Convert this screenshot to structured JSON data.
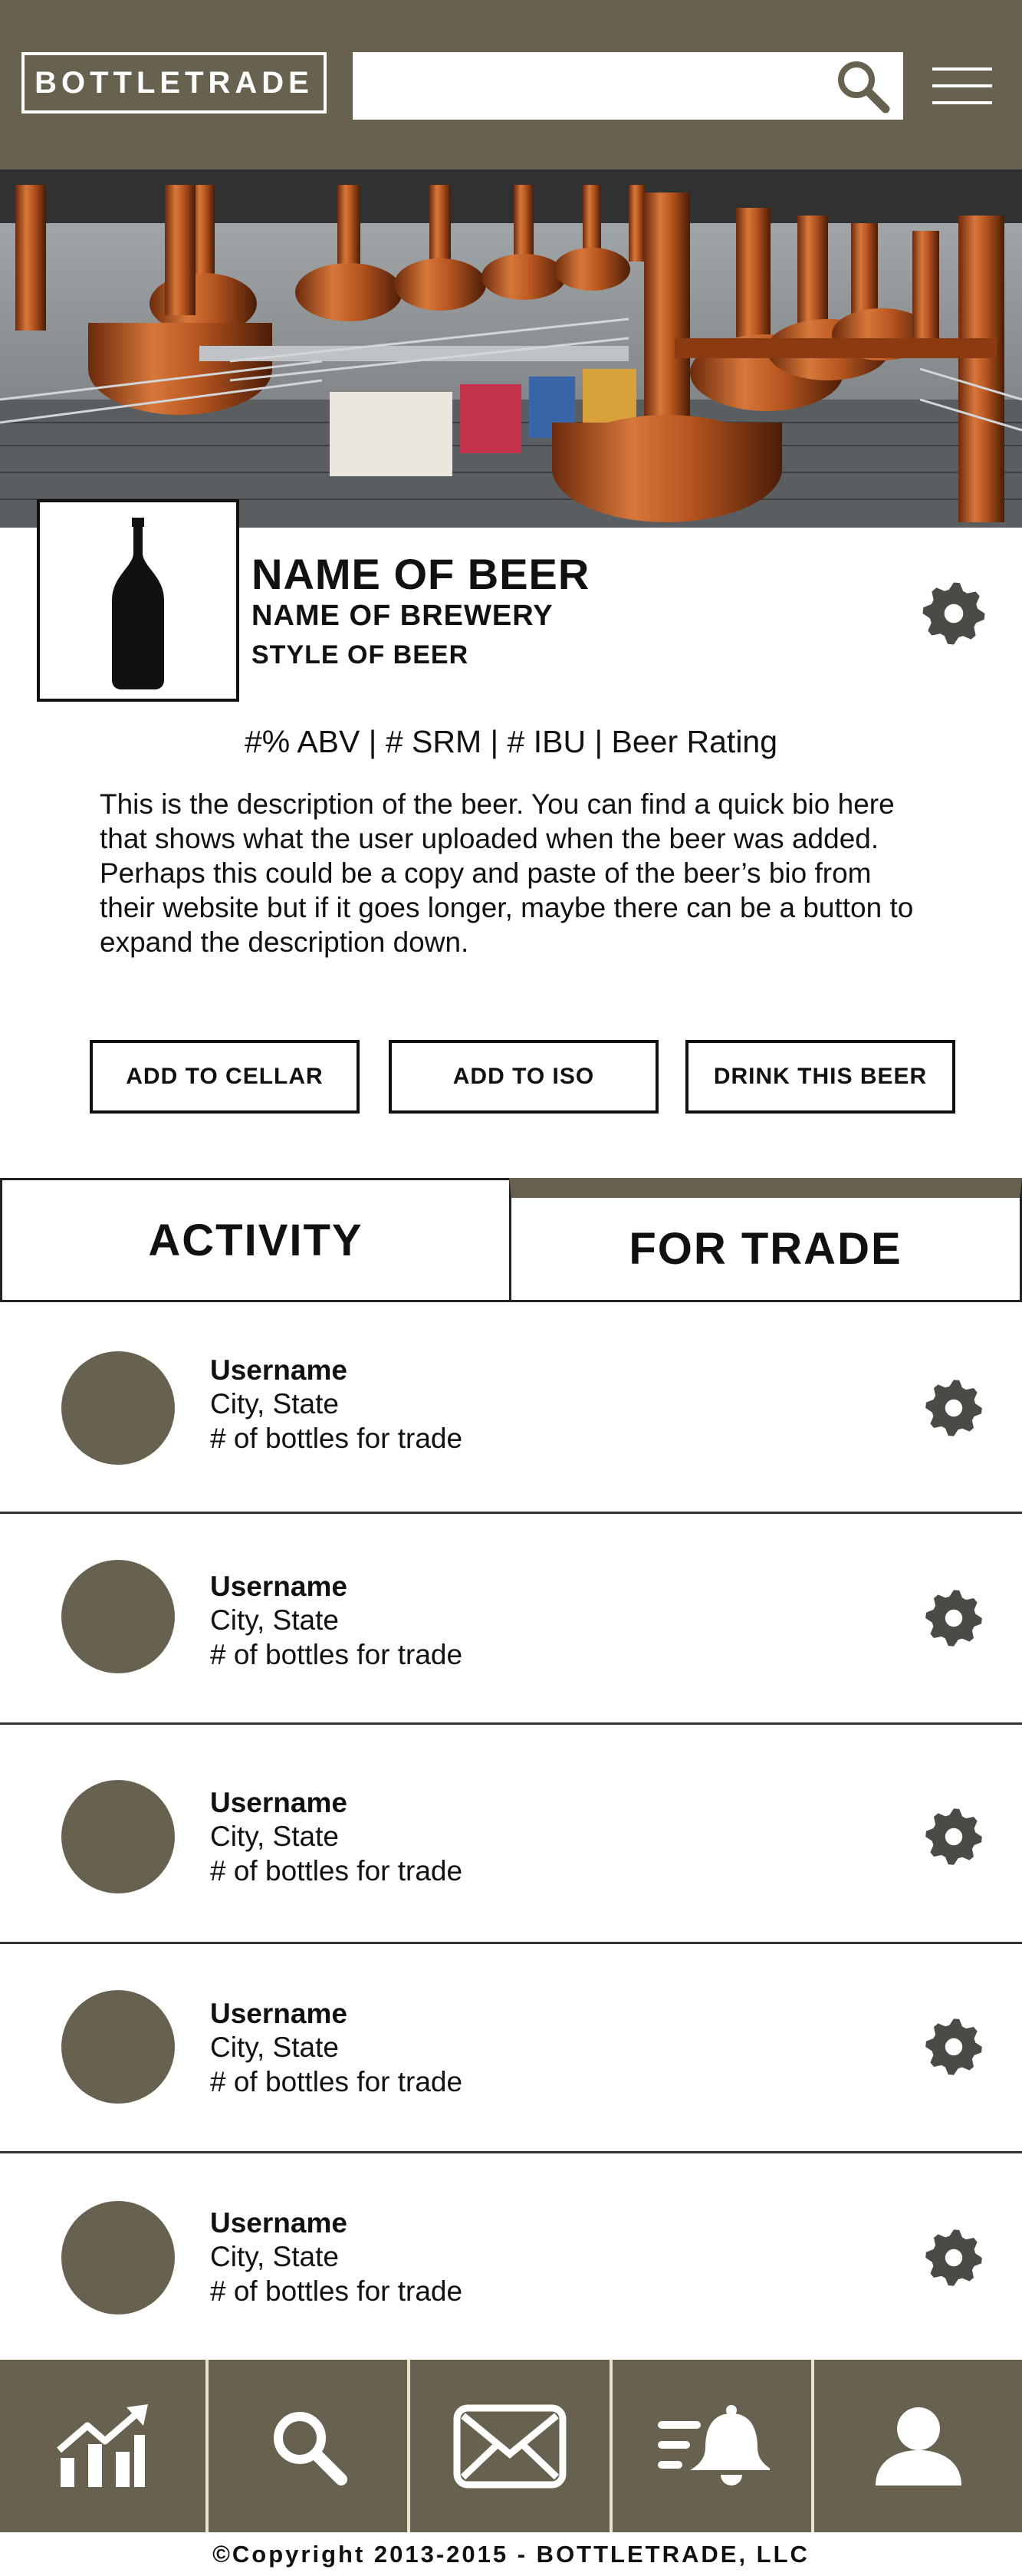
{
  "header": {
    "logo_text": "BOTTLETRADE",
    "search_placeholder": "",
    "search_icon": "search-icon",
    "menu_icon": "hamburger-menu-icon"
  },
  "beer": {
    "name": "NAME OF BEER",
    "brewery": "NAME OF BREWERY",
    "style": "STYLE OF BEER",
    "stats": "#% ABV | # SRM | # IBU | Beer Rating",
    "description": "This is the description of the beer. You can find a quick bio here that shows what the user uploaded when the beer was added. Perhaps this could be a copy and paste of the beer’s bio from their website but if it goes longer, maybe there can be a button to expand the description down."
  },
  "actions": {
    "add_to_cellar": "ADD TO CELLAR",
    "add_to_iso": "ADD TO ISO",
    "drink_this_beer": "DRINK THIS BEER"
  },
  "tabs": [
    {
      "label": "ACTIVITY",
      "active": false
    },
    {
      "label": "FOR TRADE",
      "active": true
    }
  ],
  "traders": [
    {
      "username": "Username",
      "location": "City, State",
      "bottles": "# of bottles for trade"
    },
    {
      "username": "Username",
      "location": "City, State",
      "bottles": "# of bottles for trade"
    },
    {
      "username": "Username",
      "location": "City, State",
      "bottles": "# of bottles for trade"
    },
    {
      "username": "Username",
      "location": "City, State",
      "bottles": "# of bottles for trade"
    },
    {
      "username": "Username",
      "location": "City, State",
      "bottles": "# of bottles for trade"
    }
  ],
  "bottom_nav": [
    "stats-chart-icon",
    "search-icon",
    "mail-icon",
    "notifications-icon",
    "profile-icon"
  ],
  "footer": "©Copyright 2013-2015 - BOTTLETRADE, LLC",
  "colors": {
    "brand": "#66624f",
    "divider": "#e9e5c8",
    "copper": "#b5541e"
  }
}
